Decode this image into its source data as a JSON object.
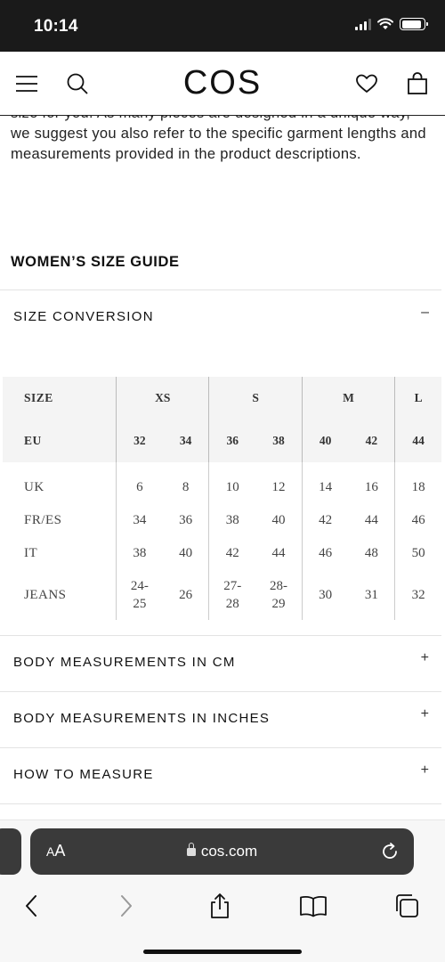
{
  "status_bar": {
    "time": "10:14"
  },
  "header": {
    "logo": "COS"
  },
  "intro_text": "size for you. As many pieces are designed in a unique way, we suggest you also refer to the specific garment lengths and measurements provided in the product descriptions.",
  "guide_title": "WOMEN’S SIZE GUIDE",
  "size_conversion": {
    "label": "SIZE CONVERSION",
    "toggle": "–",
    "header": {
      "label": "SIZE",
      "groups": [
        "XS",
        "S",
        "M",
        "L"
      ]
    },
    "eu": {
      "label": "EU",
      "values": [
        "32",
        "34",
        "36",
        "38",
        "40",
        "42",
        "44"
      ]
    },
    "rows": [
      {
        "label": "UK",
        "values": [
          "6",
          "8",
          "10",
          "12",
          "14",
          "16",
          "18"
        ]
      },
      {
        "label": "FR/ES",
        "values": [
          "34",
          "36",
          "38",
          "40",
          "42",
          "44",
          "46"
        ]
      },
      {
        "label": "IT",
        "values": [
          "38",
          "40",
          "42",
          "44",
          "46",
          "48",
          "50"
        ]
      },
      {
        "label": "JEANS",
        "values": [
          "24-\n25",
          "26",
          "27-\n28",
          "28-\n29",
          "30",
          "31",
          "32"
        ]
      }
    ]
  },
  "accordions": [
    {
      "label": "BODY MEASUREMENTS IN CM",
      "toggle": "+"
    },
    {
      "label": "BODY MEASUREMENTS IN INCHES",
      "toggle": "+"
    },
    {
      "label": "HOW TO MEASURE",
      "toggle": "+"
    }
  ],
  "browser": {
    "aa_label": "AA",
    "url": "cos.com"
  }
}
